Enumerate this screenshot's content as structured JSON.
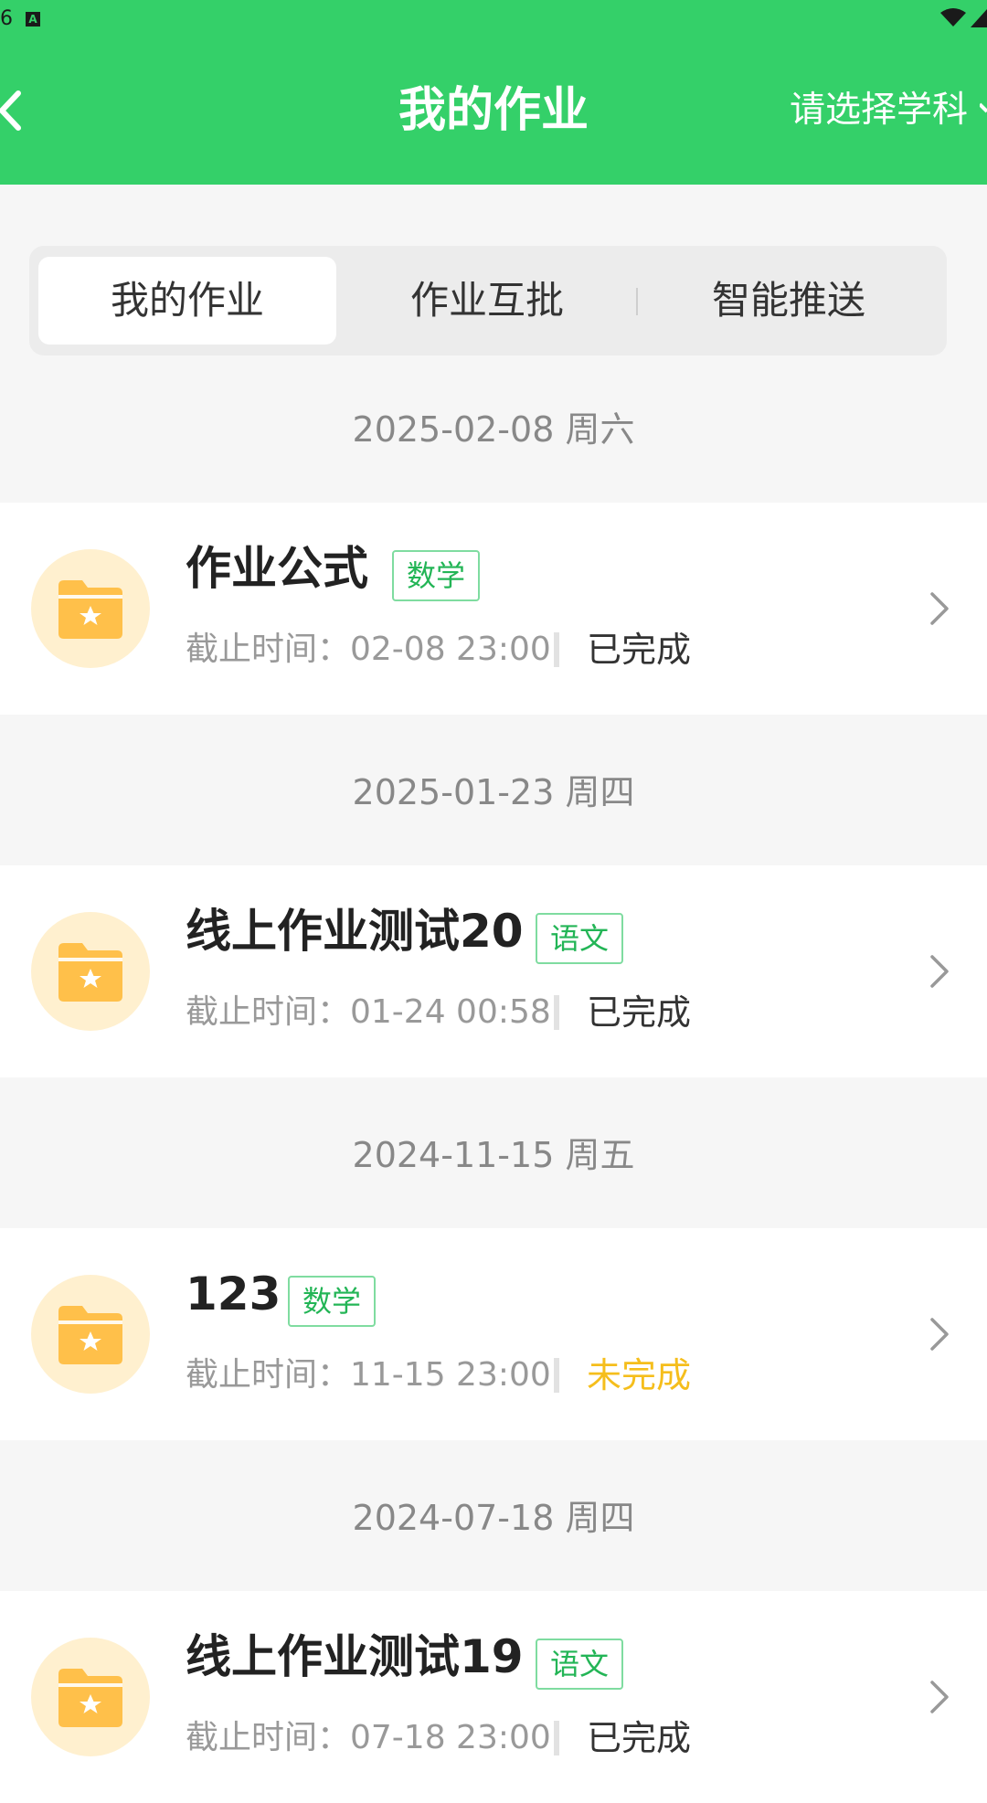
{
  "status_bar": {
    "left_text": "6",
    "a_icon": "A"
  },
  "header": {
    "title": "我的作业",
    "subject_select": "请选择学科"
  },
  "tabs": [
    {
      "label": "我的作业",
      "active": true
    },
    {
      "label": "作业互批",
      "active": false
    },
    {
      "label": "智能推送",
      "active": false
    }
  ],
  "assignments": [
    {
      "date": "2025-02-08 周六",
      "title": "作业公式",
      "subject": "数学",
      "deadline": "截止时间：02-08 23:00",
      "status": "已完成"
    },
    {
      "date": "2025-01-23 周四",
      "title": "线上作业测试20",
      "subject": "语文",
      "deadline": "截止时间：01-24 00:58",
      "status": "已完成"
    },
    {
      "date": "2024-11-15 周五",
      "title": "123",
      "subject": "数学",
      "deadline": "截止时间：11-15 23:00",
      "status": "未完成"
    },
    {
      "date": "2024-07-18 周四",
      "title": "线上作业测试19",
      "subject": "语文",
      "deadline": "截止时间：07-18 23:00",
      "status": "已完成"
    }
  ],
  "colors": {
    "brand_green": "#34d069",
    "tag_green": "#23b556",
    "folder_orange": "#ffc04a",
    "incomplete_yellow": "#f5be1c"
  }
}
